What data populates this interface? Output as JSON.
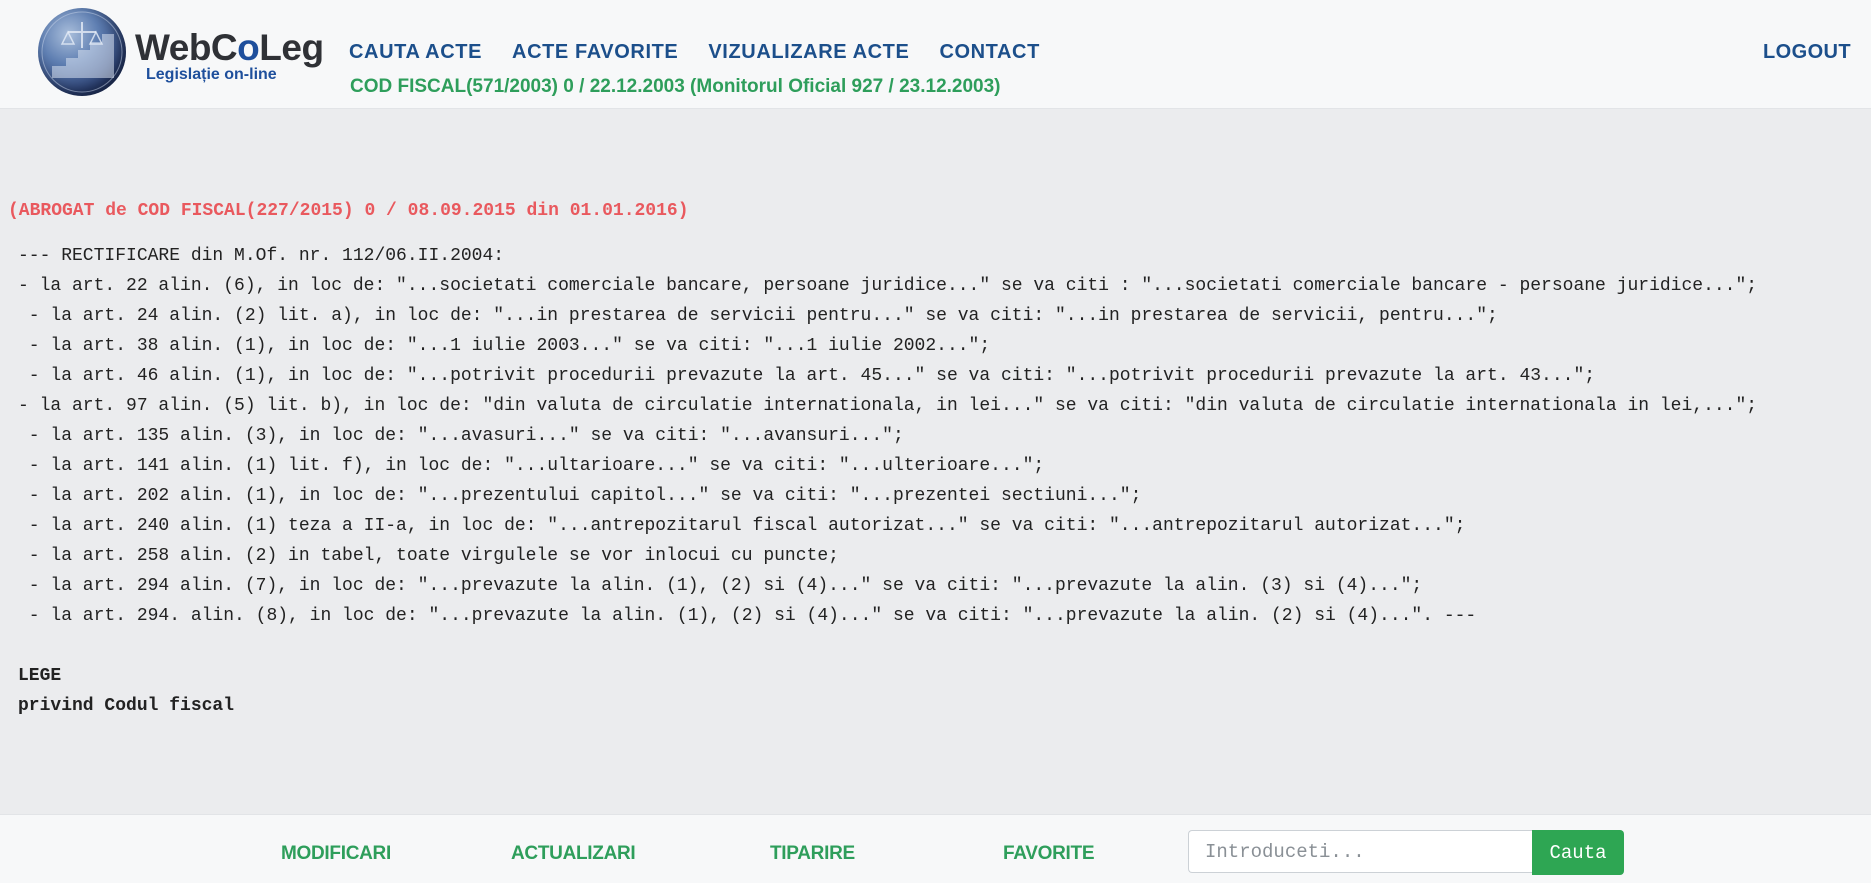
{
  "header": {
    "logo": {
      "word_a": "WebC",
      "word_b": "o",
      "word_c": "Leg",
      "subtitle": "Legislație on-line"
    },
    "nav": [
      "CAUTA ACTE",
      "ACTE FAVORITE",
      "VIZUALIZARE ACTE",
      "CONTACT"
    ],
    "logout": "LOGOUT",
    "act_title": "COD FISCAL(571/2003) 0 / 22.12.2003 (Monitorul Oficial 927 / 23.12.2003)"
  },
  "document": {
    "abrogat": "(ABROGAT de COD FISCAL(227/2015) 0 / 08.09.2015 din 01.01.2016)",
    "lines": [
      "--- RECTIFICARE din M.Of. nr. 112/06.II.2004:",
      " - la art. 22 alin. (6), in loc de: \"...societati comerciale bancare, persoane juridice...\" se va citi : \"...societati comerciale bancare - persoane juridice...\";",
      " - la art. 24 alin. (2) lit. a), in loc de: \"...in prestarea de servicii pentru...\" se va citi: \"...in prestarea de servicii, pentru...\";",
      " - la art. 38 alin. (1), in loc de: \"...1 iulie 2003...\" se va citi: \"...1 iulie 2002...\";",
      " - la art. 46 alin. (1), in loc de: \"...potrivit procedurii prevazute la art. 45...\" se va citi: \"...potrivit procedurii prevazute la art. 43...\";",
      " - la art. 97 alin. (5) lit. b), in loc de: \"din valuta de circulatie internationala, in lei...\" se va citi: \"din valuta de circulatie internationala in lei,...\";",
      " - la art. 135 alin. (3), in loc de: \"...avasuri...\" se va citi: \"...avansuri...\";",
      " - la art. 141 alin. (1) lit. f), in loc de: \"...ultarioare...\" se va citi: \"...ulterioare...\";",
      " - la art. 202 alin. (1), in loc de: \"...prezentului capitol...\" se va citi: \"...prezentei sectiuni...\";",
      " - la art. 240 alin. (1) teza a II-a, in loc de: \"...antrepozitarul fiscal autorizat...\" se va citi: \"...antrepozitarul autorizat...\";",
      " - la art. 258 alin. (2) in tabel, toate virgulele se vor inlocui cu puncte;",
      " - la art. 294 alin. (7), in loc de: \"...prevazute la alin. (1), (2) si (4)...\" se va citi: \"...prevazute la alin. (3) si (4)...\";",
      " - la art. 294. alin. (8), in loc de: \"...prevazute la alin. (1), (2) si (4)...\" se va citi: \"...prevazute la alin. (2) si (4)...\". ---"
    ],
    "heading_1": "LEGE",
    "heading_2": "privind Codul fiscal"
  },
  "toolbar": {
    "links": [
      "MODIFICARI",
      "ACTUALIZARI",
      "TIPARIRE",
      "FAVORITE"
    ],
    "search_placeholder": "Introduceti...",
    "search_button": "Cauta"
  },
  "colors": {
    "nav": "#1c4f8b",
    "accent_green": "#2e9e5b",
    "abrogat_red": "#e9595e",
    "button_green": "#2ea653"
  },
  "icons": [
    "webcoleg-logo-globe"
  ]
}
